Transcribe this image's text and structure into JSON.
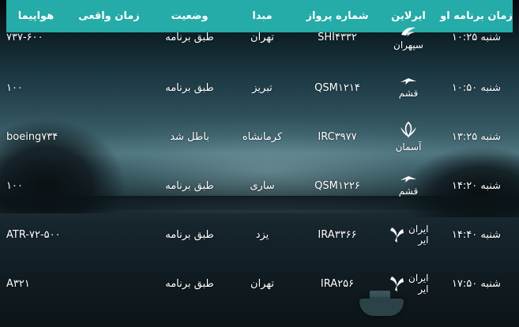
{
  "columns": {
    "scheduled_time": "زمان برنامه او",
    "airline": "ایرلاین",
    "flight_no": "شماره پرواز",
    "origin": "مبدا",
    "status": "وضعیت",
    "actual_time": "زمان واقعی",
    "aircraft": "هواپیما"
  },
  "rows": [
    {
      "scheduled_time": "شنبه ۱۰:۲۵",
      "airline": "سپهران",
      "airline_icon": "sepehran-logo-icon",
      "flight_no": "SHI۴۳۳۲",
      "origin": "تهران",
      "status": "طبق برنامه",
      "actual_time": "",
      "aircraft": "۷۳۷-۶۰۰"
    },
    {
      "scheduled_time": "شنبه ۱۰:۵۰",
      "airline": "قشم",
      "airline_icon": "qeshm-logo-icon",
      "flight_no": "QSM۱۲۱۴",
      "origin": "تبریز",
      "status": "طبق برنامه",
      "actual_time": "",
      "aircraft": "۱۰۰"
    },
    {
      "scheduled_time": "شنبه ۱۳:۲۵",
      "airline": "آسمان",
      "airline_icon": "aseman-logo-icon",
      "flight_no": "IRC۳۹۷۷",
      "origin": "کرمانشاه",
      "status": "باطل شد",
      "actual_time": "",
      "aircraft": "boeing۷۳۴"
    },
    {
      "scheduled_time": "شنبه ۱۴:۲۰",
      "airline": "قشم",
      "airline_icon": "qeshm-logo-icon",
      "flight_no": "QSM۱۲۲۶",
      "origin": "ساری",
      "status": "طبق برنامه",
      "actual_time": "",
      "aircraft": "۱۰۰"
    },
    {
      "scheduled_time": "شنبه ۱۴:۴۰",
      "airline": "ایران ایر",
      "airline_icon": "iranair-logo-icon",
      "flight_no": "IRA۳۳۶۶",
      "origin": "یزد",
      "status": "طبق برنامه",
      "actual_time": "",
      "aircraft": "ATR-۷۲-۵۰۰"
    },
    {
      "scheduled_time": "شنبه ۱۷:۵۰",
      "airline": "ایران ایر",
      "airline_icon": "iranair-logo-icon",
      "flight_no": "IRA۲۵۶",
      "origin": "تهران",
      "status": "طبق برنامه",
      "actual_time": "",
      "aircraft": "A۳۲۱"
    }
  ],
  "colors": {
    "header_bg": "#25aba8",
    "text": "#ffffff"
  }
}
